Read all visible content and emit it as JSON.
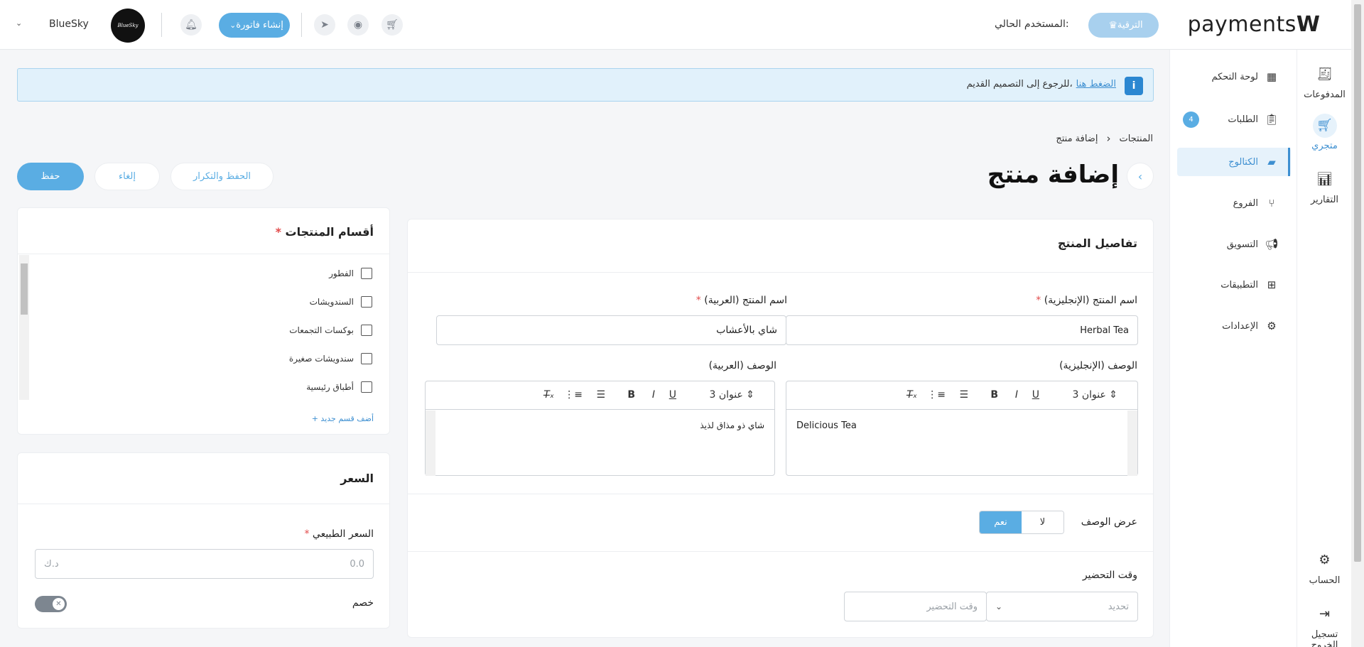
{
  "topbar": {
    "brand": "payments",
    "brand_mark": "W",
    "upgrade_label": "الترقية",
    "current_user_label": "المستخدم الحالي:",
    "create_invoice_label": "إنشاء فاتورة",
    "store_name": "BlueSky",
    "store_logo_text": "BlueSky"
  },
  "rail": {
    "items": [
      {
        "label": "المدفوعات",
        "icon": "receipt-icon"
      },
      {
        "label": "متجري",
        "icon": "cart-icon"
      },
      {
        "label": "التقارير",
        "icon": "bar-chart-icon"
      },
      {
        "label": "الحساب",
        "icon": "account-icon"
      },
      {
        "label": "تسجيل الخروج",
        "icon": "logout-icon"
      }
    ]
  },
  "nav": {
    "items": [
      {
        "label": "لوحة التحكم",
        "icon": "grid-icon"
      },
      {
        "label": "الطلبات",
        "icon": "clipboard-icon",
        "badge": "4"
      },
      {
        "label": "الكتالوج",
        "icon": "book-icon",
        "active": true
      },
      {
        "label": "الفروع",
        "icon": "branch-icon"
      },
      {
        "label": "التسويق",
        "icon": "megaphone-icon"
      },
      {
        "label": "التطبيقات",
        "icon": "apps-icon"
      },
      {
        "label": "الإعدادات",
        "icon": "gear-icon"
      }
    ]
  },
  "banner": {
    "text": "للرجوع إلى التصميم القديم،",
    "link": "الضغط هنا"
  },
  "breadcrumb": {
    "parent": "المنتجات",
    "current": "إضافة منتج"
  },
  "page": {
    "title": "إضافة منتج",
    "save_label": "حفظ",
    "cancel_label": "إلغاء",
    "save_repeat_label": "الحفظ والتكرار"
  },
  "details": {
    "title": "تفاصيل المنتج",
    "name_en_label": "اسم المنتج (الإنجليزية)",
    "name_en_value": "Herbal Tea",
    "name_ar_label": "اسم المنتج (العربية)",
    "name_ar_value": "شاي بالأعشاب",
    "desc_en_label": "الوصف (الإنجليزية)",
    "desc_en_value": "Delicious Tea",
    "desc_ar_label": "الوصف (العربية)",
    "desc_ar_value": "شاي ذو مذاق لذيذ",
    "heading_select": "عنوان 3",
    "show_desc_label": "عرض الوصف",
    "yes_label": "نعم",
    "no_label": "لا",
    "show_desc_value": "نعم",
    "prep_time_label": "وقت التحضير",
    "prep_time_placeholder": "وقت التحضير",
    "prep_unit_placeholder": "تحديد"
  },
  "categories": {
    "title": "أقسام المنتجات",
    "items": [
      "الفطور",
      "السندويشات",
      "بوكسات التجمعات",
      "سندويشات صغيرة",
      "أطباق رئيسية"
    ],
    "add_new": "+ أضف قسم جديد"
  },
  "price": {
    "title": "السعر",
    "regular_label": "السعر الطبيعي",
    "regular_placeholder": "0.0",
    "currency": "د.ك",
    "discount_label": "خصم"
  },
  "colors": {
    "accent": "#5aade3",
    "banner_bg": "#e1f1fb"
  }
}
